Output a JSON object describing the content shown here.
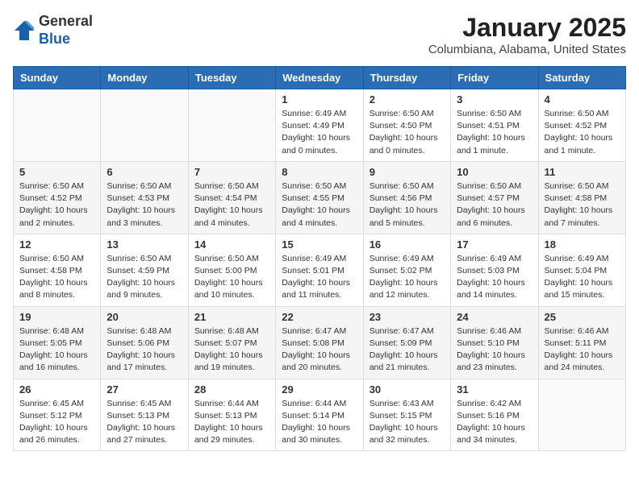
{
  "header": {
    "logo_line1": "General",
    "logo_line2": "Blue",
    "month_title": "January 2025",
    "location": "Columbiana, Alabama, United States"
  },
  "weekdays": [
    "Sunday",
    "Monday",
    "Tuesday",
    "Wednesday",
    "Thursday",
    "Friday",
    "Saturday"
  ],
  "weeks": [
    [
      {
        "day": "",
        "info": ""
      },
      {
        "day": "",
        "info": ""
      },
      {
        "day": "",
        "info": ""
      },
      {
        "day": "1",
        "info": "Sunrise: 6:49 AM\nSunset: 4:49 PM\nDaylight: 10 hours\nand 0 minutes."
      },
      {
        "day": "2",
        "info": "Sunrise: 6:50 AM\nSunset: 4:50 PM\nDaylight: 10 hours\nand 0 minutes."
      },
      {
        "day": "3",
        "info": "Sunrise: 6:50 AM\nSunset: 4:51 PM\nDaylight: 10 hours\nand 1 minute."
      },
      {
        "day": "4",
        "info": "Sunrise: 6:50 AM\nSunset: 4:52 PM\nDaylight: 10 hours\nand 1 minute."
      }
    ],
    [
      {
        "day": "5",
        "info": "Sunrise: 6:50 AM\nSunset: 4:52 PM\nDaylight: 10 hours\nand 2 minutes."
      },
      {
        "day": "6",
        "info": "Sunrise: 6:50 AM\nSunset: 4:53 PM\nDaylight: 10 hours\nand 3 minutes."
      },
      {
        "day": "7",
        "info": "Sunrise: 6:50 AM\nSunset: 4:54 PM\nDaylight: 10 hours\nand 4 minutes."
      },
      {
        "day": "8",
        "info": "Sunrise: 6:50 AM\nSunset: 4:55 PM\nDaylight: 10 hours\nand 4 minutes."
      },
      {
        "day": "9",
        "info": "Sunrise: 6:50 AM\nSunset: 4:56 PM\nDaylight: 10 hours\nand 5 minutes."
      },
      {
        "day": "10",
        "info": "Sunrise: 6:50 AM\nSunset: 4:57 PM\nDaylight: 10 hours\nand 6 minutes."
      },
      {
        "day": "11",
        "info": "Sunrise: 6:50 AM\nSunset: 4:58 PM\nDaylight: 10 hours\nand 7 minutes."
      }
    ],
    [
      {
        "day": "12",
        "info": "Sunrise: 6:50 AM\nSunset: 4:58 PM\nDaylight: 10 hours\nand 8 minutes."
      },
      {
        "day": "13",
        "info": "Sunrise: 6:50 AM\nSunset: 4:59 PM\nDaylight: 10 hours\nand 9 minutes."
      },
      {
        "day": "14",
        "info": "Sunrise: 6:50 AM\nSunset: 5:00 PM\nDaylight: 10 hours\nand 10 minutes."
      },
      {
        "day": "15",
        "info": "Sunrise: 6:49 AM\nSunset: 5:01 PM\nDaylight: 10 hours\nand 11 minutes."
      },
      {
        "day": "16",
        "info": "Sunrise: 6:49 AM\nSunset: 5:02 PM\nDaylight: 10 hours\nand 12 minutes."
      },
      {
        "day": "17",
        "info": "Sunrise: 6:49 AM\nSunset: 5:03 PM\nDaylight: 10 hours\nand 14 minutes."
      },
      {
        "day": "18",
        "info": "Sunrise: 6:49 AM\nSunset: 5:04 PM\nDaylight: 10 hours\nand 15 minutes."
      }
    ],
    [
      {
        "day": "19",
        "info": "Sunrise: 6:48 AM\nSunset: 5:05 PM\nDaylight: 10 hours\nand 16 minutes."
      },
      {
        "day": "20",
        "info": "Sunrise: 6:48 AM\nSunset: 5:06 PM\nDaylight: 10 hours\nand 17 minutes."
      },
      {
        "day": "21",
        "info": "Sunrise: 6:48 AM\nSunset: 5:07 PM\nDaylight: 10 hours\nand 19 minutes."
      },
      {
        "day": "22",
        "info": "Sunrise: 6:47 AM\nSunset: 5:08 PM\nDaylight: 10 hours\nand 20 minutes."
      },
      {
        "day": "23",
        "info": "Sunrise: 6:47 AM\nSunset: 5:09 PM\nDaylight: 10 hours\nand 21 minutes."
      },
      {
        "day": "24",
        "info": "Sunrise: 6:46 AM\nSunset: 5:10 PM\nDaylight: 10 hours\nand 23 minutes."
      },
      {
        "day": "25",
        "info": "Sunrise: 6:46 AM\nSunset: 5:11 PM\nDaylight: 10 hours\nand 24 minutes."
      }
    ],
    [
      {
        "day": "26",
        "info": "Sunrise: 6:45 AM\nSunset: 5:12 PM\nDaylight: 10 hours\nand 26 minutes."
      },
      {
        "day": "27",
        "info": "Sunrise: 6:45 AM\nSunset: 5:13 PM\nDaylight: 10 hours\nand 27 minutes."
      },
      {
        "day": "28",
        "info": "Sunrise: 6:44 AM\nSunset: 5:13 PM\nDaylight: 10 hours\nand 29 minutes."
      },
      {
        "day": "29",
        "info": "Sunrise: 6:44 AM\nSunset: 5:14 PM\nDaylight: 10 hours\nand 30 minutes."
      },
      {
        "day": "30",
        "info": "Sunrise: 6:43 AM\nSunset: 5:15 PM\nDaylight: 10 hours\nand 32 minutes."
      },
      {
        "day": "31",
        "info": "Sunrise: 6:42 AM\nSunset: 5:16 PM\nDaylight: 10 hours\nand 34 minutes."
      },
      {
        "day": "",
        "info": ""
      }
    ]
  ]
}
